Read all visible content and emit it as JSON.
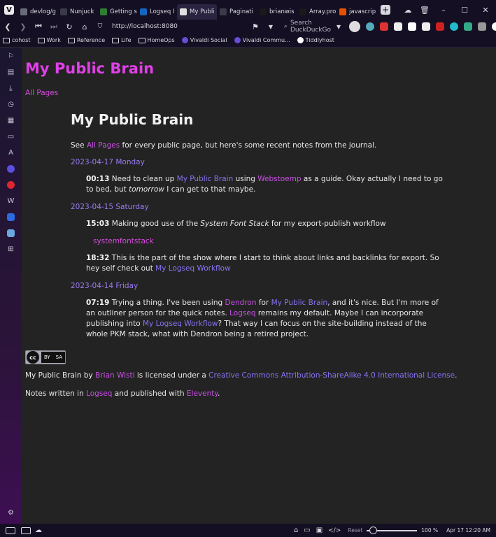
{
  "browser": {
    "tabs": [
      {
        "label": "devlog/g",
        "color": "#6a6a7a"
      },
      {
        "label": "Nunjuck",
        "color": "#3a3a4a"
      },
      {
        "label": "Getting s",
        "color": "#2e7d32"
      },
      {
        "label": "Logseq I",
        "color": "#1565c0"
      },
      {
        "label": "My Publi",
        "color": "#e0e0e0",
        "active": true
      },
      {
        "label": "Paginati",
        "color": "#3a3a4a"
      },
      {
        "label": "brianwis",
        "color": "#1a1a1a"
      },
      {
        "label": "Array.pro",
        "color": "#1a1a1a"
      },
      {
        "label": "javascrip",
        "color": "#e65100"
      }
    ],
    "url": "http://localhost:8080",
    "search_placeholder": "Search DuckDuckGo",
    "bookmarks": [
      {
        "label": "cohost",
        "type": "folder"
      },
      {
        "label": "Work",
        "type": "folder"
      },
      {
        "label": "Reference",
        "type": "folder"
      },
      {
        "label": "Life",
        "type": "folder"
      },
      {
        "label": "HomeOps",
        "type": "folder"
      },
      {
        "label": "Vivaldi Social",
        "type": "site",
        "color": "#6a4cd8"
      },
      {
        "label": "Vivaldi Commu...",
        "type": "site",
        "color": "#6a4cd8"
      },
      {
        "label": "Tiddlyhost",
        "type": "site",
        "color": "#ffffff"
      }
    ],
    "status": {
      "reset_label": "Reset",
      "zoom": "100 %",
      "clock": "Apr 17 12:20 AM"
    }
  },
  "page": {
    "site_title": "My Public Brain",
    "nav_all_pages": "All Pages",
    "heading": "My Public Brain",
    "intro": {
      "prefix": "See ",
      "link": "All Pages",
      "suffix": " for every public page, but here's some recent notes from the journal."
    },
    "journal": [
      {
        "date": "2023-04-17 Monday",
        "entries": [
          {
            "time": "00:13",
            "parts": [
              {
                "t": " Need to clean up "
              },
              {
                "t": "My Public Brain",
                "c": "b"
              },
              {
                "t": " using "
              },
              {
                "t": "Webstoemp",
                "c": "p"
              },
              {
                "t": " as a guide. Okay actually I need to go to bed, but "
              },
              {
                "t": "tomorrow",
                "c": "i"
              },
              {
                "t": " I can get to that maybe."
              }
            ]
          }
        ]
      },
      {
        "date": "2023-04-15 Saturday",
        "entries": [
          {
            "time": "15:03",
            "parts": [
              {
                "t": " Making good use of the "
              },
              {
                "t": "System Font Stack",
                "c": "i"
              },
              {
                "t": " for my export-publish workflow"
              }
            ],
            "tag": "systemfontstack"
          },
          {
            "time": "18:32",
            "parts": [
              {
                "t": " This is the part of the show where I start to think about links and backlinks for export. So hey self check out "
              },
              {
                "t": "My Logseq Workflow",
                "c": "b"
              }
            ]
          }
        ]
      },
      {
        "date": "2023-04-14 Friday",
        "entries": [
          {
            "time": "07:19",
            "parts": [
              {
                "t": " Trying a thing. I've been using "
              },
              {
                "t": "Dendron",
                "c": "p"
              },
              {
                "t": " for "
              },
              {
                "t": "My Public Brain",
                "c": "b"
              },
              {
                "t": ", and it's nice. But I'm more of an outliner person for the quick notes. "
              },
              {
                "t": "Logseq",
                "c": "p"
              },
              {
                "t": " remains my default. Maybe I can incorporate publishing into "
              },
              {
                "t": "My Logseq Workflow",
                "c": "b"
              },
              {
                "t": "? That way I can focus on the site-building instead of the whole PKM stack, what with Dendron being a retired project."
              }
            ]
          }
        ]
      }
    ],
    "license": {
      "badge_cc": "cc",
      "badge_by": "BY",
      "badge_sa": "SA",
      "prefix": "My Public Brain by ",
      "author": "Brian Wisti",
      "middle": " is licensed under a ",
      "license_link": "Creative Commons Attribution-ShareAlike 4.0 International License",
      "suffix": "."
    },
    "notes": {
      "prefix": "Notes written in ",
      "tool1": "Logseq",
      "middle": " and published with ",
      "tool2": "Eleventy",
      "suffix": "."
    }
  }
}
